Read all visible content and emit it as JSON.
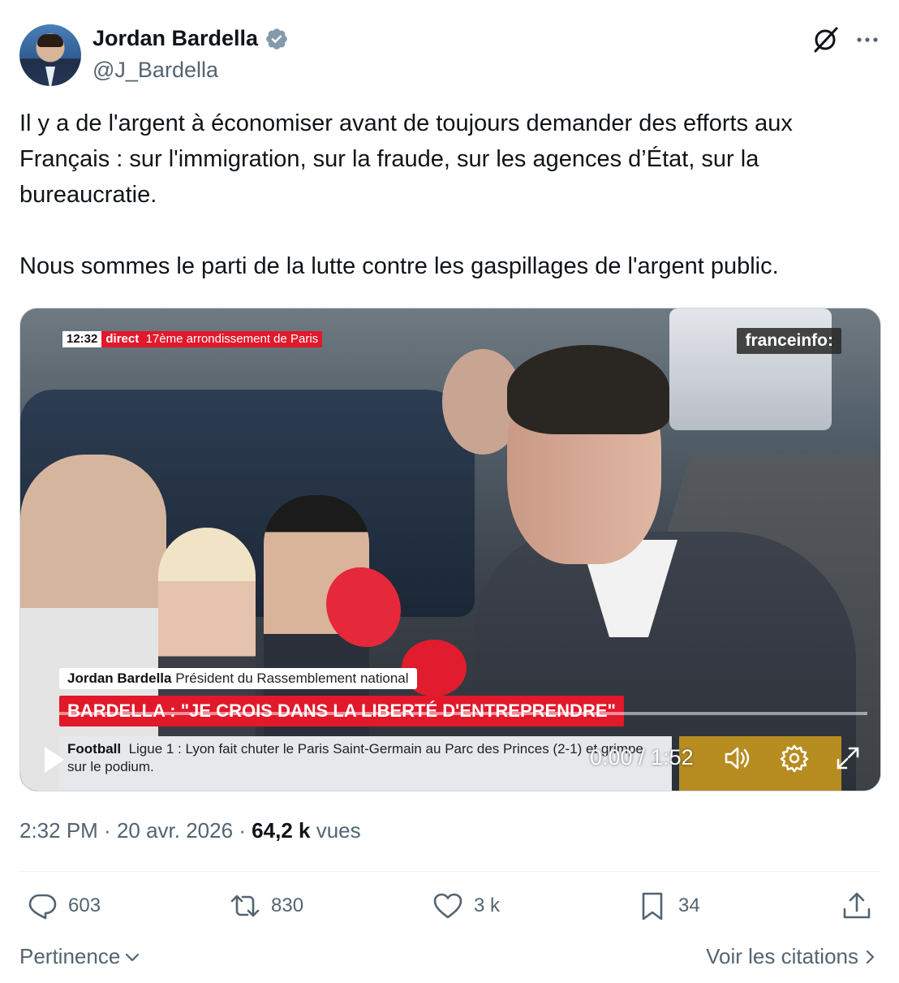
{
  "author": {
    "name": "Jordan Bardella",
    "handle": "@J_Bardella",
    "verified_color": "#829aab"
  },
  "icons": {
    "grok": "slashed-circle-icon",
    "more": "more-horizontal-icon"
  },
  "tweet": {
    "text": "Il y a de l'argent à économiser avant de toujours demander des efforts aux Français : sur l'immigration, sur la fraude, sur les agences d’État, sur la bureaucratie.\n\nNous sommes le parti de la lutte contre les gaspillages de l'argent public."
  },
  "video": {
    "live_time": "12:32",
    "live_label": "direct",
    "live_location": "17ème arrondissement de Paris",
    "channel": "franceinfo:",
    "speaker_name": "Jordan Bardella",
    "speaker_title": "Président du Rassemblement national",
    "headline": "BARDELLA : \"JE CROIS DANS LA LIBERTÉ D'ENTREPRENDRE\"",
    "ticker_category": "Football",
    "ticker_text": "Ligue 1 : Lyon fait chuter le Paris Saint-Germain au Parc des Princes (2-1) et grimpe sur le podium.",
    "timecode": "0:00 / 1:52",
    "progress": 0,
    "accent_red": "#e2182b"
  },
  "meta": {
    "time": "2:32 PM",
    "sep1": " · ",
    "date": "20 avr. 2026",
    "sep2": " · ",
    "views_count": "64,2 k",
    "views_label": "vues"
  },
  "actions": {
    "replies": "603",
    "reposts": "830",
    "likes": "3 k",
    "bookmarks": "34"
  },
  "footer": {
    "sort_label": "Pertinence",
    "quotes_label": "Voir les citations"
  }
}
